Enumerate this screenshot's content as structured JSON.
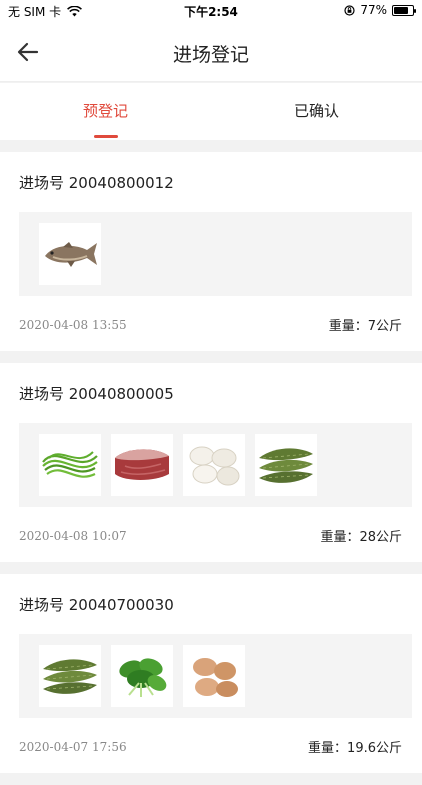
{
  "status_bar": {
    "carrier": "无 SIM 卡",
    "time": "下午2:54",
    "battery": "77%",
    "battery_level": 0.77
  },
  "nav": {
    "title": "进场登记"
  },
  "tabs": [
    {
      "label": "预登记",
      "active": true
    },
    {
      "label": "已确认",
      "active": false
    }
  ],
  "records": [
    {
      "title": "进场号 20040800012",
      "date": "2020-04-08 13:55",
      "weight": "重量：7公斤",
      "items": [
        "fish-image"
      ]
    },
    {
      "title": "进场号 20040800005",
      "date": "2020-04-08 10:07",
      "weight": "重量：28公斤",
      "items": [
        "long-beans-image",
        "pork-image",
        "eggs-image",
        "loofah-image"
      ]
    },
    {
      "title": "进场号 20040700030",
      "date": "2020-04-07 17:56",
      "weight": "重量：19.6公斤",
      "items": [
        "loofah-image",
        "leafy-greens-image",
        "eggs-image"
      ]
    }
  ]
}
